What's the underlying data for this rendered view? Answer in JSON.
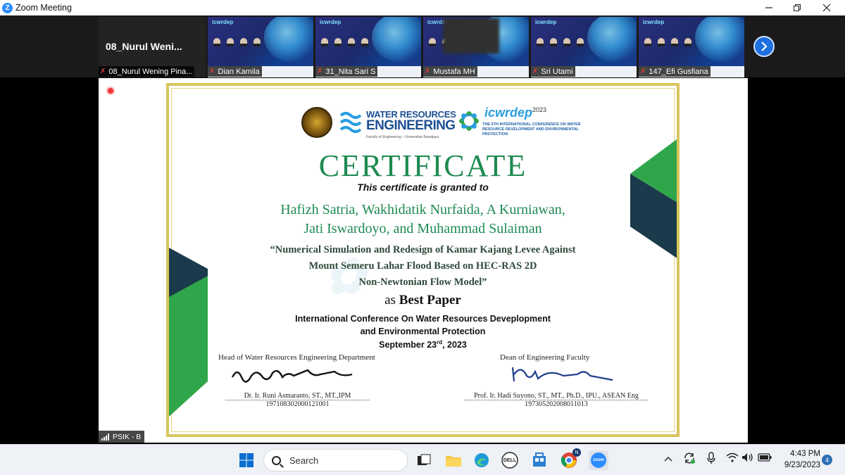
{
  "window": {
    "title": "Zoom Meeting"
  },
  "self_view": {
    "display_name": "08_Nurul  Weni...",
    "name_tag": "08_Nurul Wening Pina..."
  },
  "participants": [
    {
      "name": "Dian Kamila"
    },
    {
      "name": "31_Nita Sari S"
    },
    {
      "name": "Mustafa MH"
    },
    {
      "name": "Sri Utami"
    },
    {
      "name": "147_Efi Gusfiana"
    }
  ],
  "tile_logo": "icwrdep",
  "next_page_icon": "chevron-right-icon",
  "certificate": {
    "logo_wre_line1": "WATER RESOURCES",
    "logo_wre_line2": "ENGINEERING",
    "logo_wre_line3": "Faculty of Engineering – Universitas Brawijaya",
    "logo_icw_name": "icwrdep",
    "logo_icw_year": "2023",
    "logo_icw_desc": "THE 5TH INTERNATIONAL CONFERENCE ON WATER RESOURCE DEVELOPMENT AND ENVIRONMENTAL PROTECTION",
    "heading": "CERTIFICATE",
    "granted": "This certificate is granted to",
    "names_line1": "Hafizh Satria, Wakhidatik Nurfaida, A Kurniawan,",
    "names_line2": "Jati Iswardoyo, and Muhammad Sulaiman",
    "paper_line1": "“Numerical Simulation and Redesign of Kamar Kajang Levee Against",
    "paper_line2": "Mount Semeru Lahar Flood Based on HEC-RAS 2D",
    "paper_line3": "Non-Newtonian Flow Model”",
    "award_prefix": "as",
    "award": "Best Paper",
    "conference_line1": "International Conference On Water Resources Deveplopment",
    "conference_line2": "and Environmental Protection",
    "date_prefix": "September 23",
    "date_suffix": "rd",
    "date_year": ", 2023",
    "sig_left": {
      "role": "Head of Water Resources Engineering Department",
      "name": "Dr. Ir. Runi Asmaranto, ST., MT.,IPM",
      "id": "197108302000121001"
    },
    "sig_right": {
      "role": "Dean of Engineering Faculty",
      "name": "Prof. Ir. Hadi Suyono, ST., MT., Ph.D., IPU., ASEAN Eng",
      "id": "197305202008011013"
    }
  },
  "network_label": "PSIK - B",
  "taskbar": {
    "search_placeholder": "Search",
    "clock_time": "4:43 PM",
    "clock_date": "9/23/2023",
    "notification_count": "4",
    "zoom_label": "zoom",
    "dell_label": "DELL",
    "chrome_badge": "N"
  },
  "colors": {
    "certificate_green": "#1d8a50",
    "certificate_gold": "#d8c55c",
    "zoom_blue": "#2D8CFF",
    "dark_navy": "#1b3a4b"
  }
}
